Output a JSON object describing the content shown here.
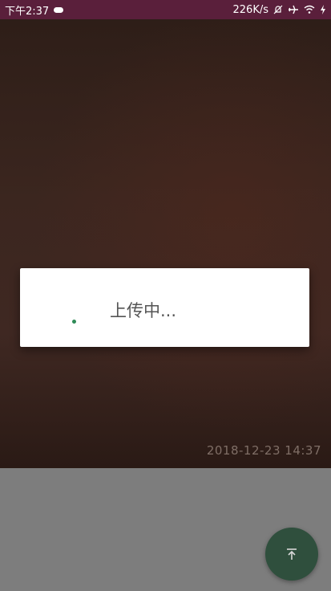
{
  "status_bar": {
    "time": "下午2:37",
    "network_speed": "226K/s",
    "icons": [
      "cloud-icon",
      "mute-icon",
      "airplane-icon",
      "wifi-icon",
      "charging-icon"
    ]
  },
  "photo": {
    "timestamp": "2018-12-23 14:37"
  },
  "dialog": {
    "message": "上传中..."
  },
  "fab": {
    "icon": "upload-arrow-icon"
  },
  "colors": {
    "status_bar": "#5a1f3b",
    "fab": "#2f4f3d",
    "spinner": "#2e8b57"
  }
}
